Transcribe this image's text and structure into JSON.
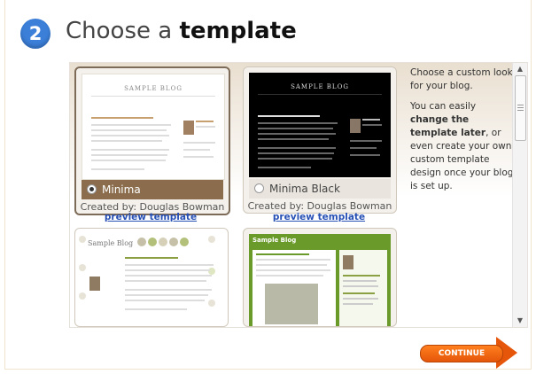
{
  "step": {
    "number": "2",
    "title_prefix": "Choose a ",
    "title_bold": "template"
  },
  "templates": [
    {
      "name": "Minima",
      "creator": "Created by: Douglas Bowman",
      "preview": "preview template",
      "selected": true,
      "thumb_title": "SAMPLE BLOG"
    },
    {
      "name": "Minima Black",
      "creator": "Created by: Douglas Bowman",
      "preview": "preview template",
      "selected": false,
      "thumb_title": "SAMPLE BLOG"
    }
  ],
  "more_templates": [
    {
      "thumb_title": "Sample Blog"
    },
    {
      "thumb_title": "Sample Blog"
    }
  ],
  "help": {
    "p1": "Choose a custom look for your blog.",
    "p2_a": "You can easily ",
    "p2_b": "change the template later",
    "p2_c": ", or even create your own custom template design once your blog is set up."
  },
  "continue_label": "CONTINUE",
  "colors": {
    "accent": "#3b7fd9",
    "selected_bar": "#8b6d4d",
    "continue": "#e5560a",
    "link": "#2750b5"
  }
}
